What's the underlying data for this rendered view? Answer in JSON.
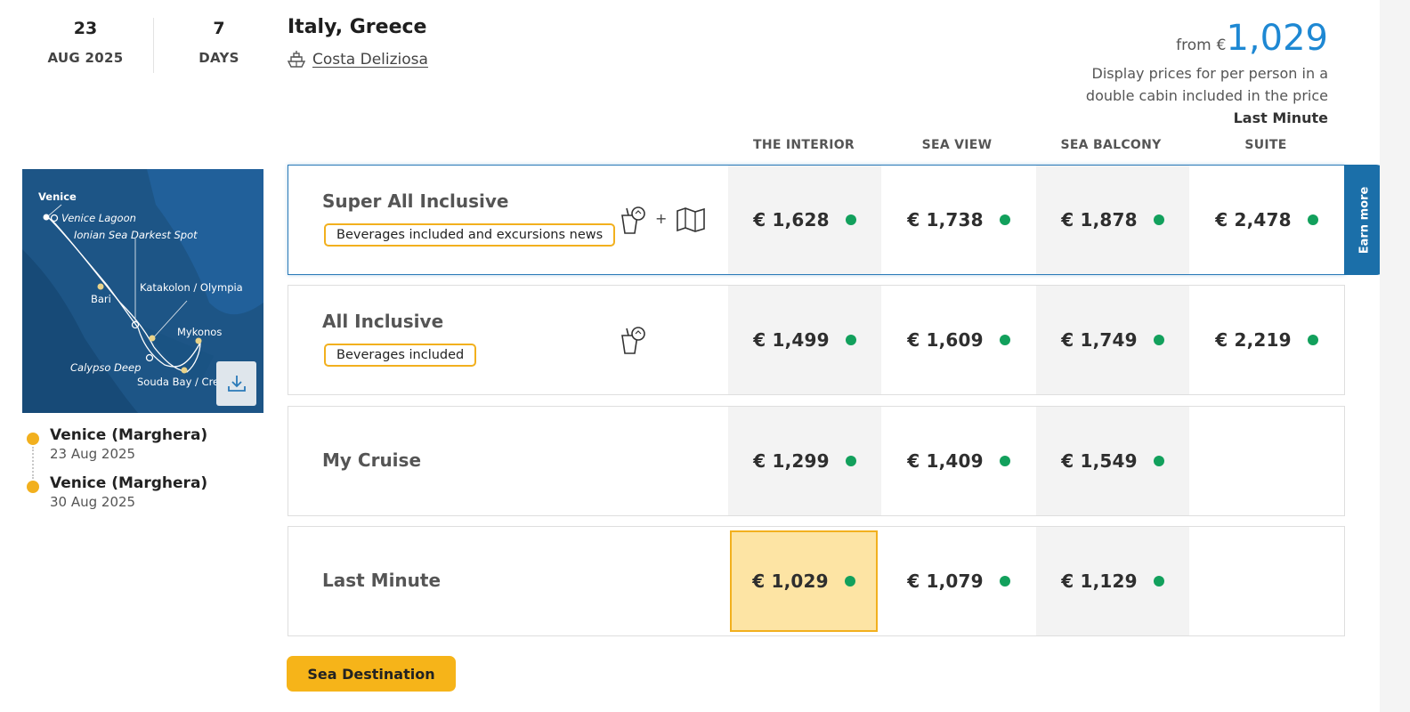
{
  "header": {
    "start_day": "23",
    "start_month": "AUG 2025",
    "duration": "7",
    "duration_unit": "DAYS",
    "destination": "Italy, Greece",
    "ship": "Costa Deliziosa",
    "from_label": "from",
    "currency": "€",
    "from_price": "1,029",
    "price_note_1": "Display prices for per person in a",
    "price_note_2": "double cabin included in the price",
    "price_tag": "Last Minute"
  },
  "cabins": [
    "THE INTERIOR",
    "SEA VIEW",
    "SEA BALCONY",
    "SUITE"
  ],
  "map": {
    "labels": [
      "Venice",
      "Venice Lagoon",
      "Ionian Sea Darkest Spot",
      "Katakolon / Olympia",
      "Bari",
      "Mykonos",
      "Calypso Deep",
      "Souda Bay / Crete"
    ],
    "download_icon": "download-icon"
  },
  "itinerary": [
    {
      "port": "Venice (Marghera)",
      "date": "23 Aug 2025"
    },
    {
      "port": "Venice (Marghera)",
      "date": "30 Aug 2025"
    }
  ],
  "fares": [
    {
      "name": "Super All Inclusive",
      "badge": "Beverages included and excursions news",
      "prices": [
        "€ 1,628",
        "€ 1,738",
        "€ 1,878",
        "€ 2,478"
      ],
      "perks": [
        "drinks-icon",
        "map-icon"
      ]
    },
    {
      "name": "All Inclusive",
      "badge": "Beverages included",
      "prices": [
        "€ 1,499",
        "€ 1,609",
        "€ 1,749",
        "€ 2,219"
      ],
      "perks": [
        "drinks-icon"
      ]
    },
    {
      "name": "My Cruise",
      "badge": "",
      "prices": [
        "€ 1,299",
        "€ 1,409",
        "€ 1,549",
        ""
      ],
      "perks": []
    },
    {
      "name": "Last Minute",
      "badge": "",
      "prices": [
        "€ 1,029",
        "€ 1,079",
        "€ 1,129",
        ""
      ],
      "perks": []
    }
  ],
  "perk_plus": "+",
  "earn_more": "Earn more",
  "cta": "Sea Destination",
  "colors": {
    "accent_blue": "#1e88d3",
    "badge_yellow": "#f2b01e",
    "available_green": "#12a05c",
    "selected_cell": "#fde4a4"
  }
}
